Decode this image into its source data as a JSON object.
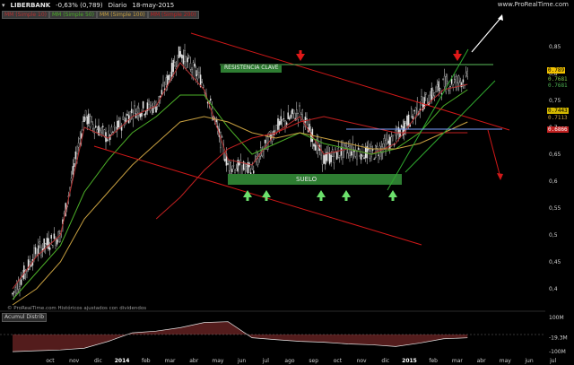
{
  "header": {
    "symbol": "LIBERBANK",
    "change": "-0,63% (0,789)",
    "period": "Diario",
    "date": "18-may-2015",
    "legend": [
      "MM (Simple 10)",
      "MM (Simple 50)",
      "MM (Simple 100)",
      "MM (Simple 200)"
    ],
    "brand": "www.ProRealTime.com"
  },
  "copyright": "© ProRealTime.com  Históricos ajustados con dividendos",
  "indicator_label": "Acumul Distrib",
  "annotations": {
    "resistance_label": "RESISTENCIA CLAVE",
    "support_label": "SUELO"
  },
  "price_tags": [
    {
      "value": "0.789",
      "color": "#f2c200",
      "text_color": "#000"
    },
    {
      "value": "0.7681",
      "color": "#000",
      "text_color": "#7ec84a"
    },
    {
      "value": "0.7681",
      "color": "#000",
      "text_color": "#4caf50"
    },
    {
      "value": "0.7443",
      "color": "#d4b800",
      "text_color": "#000"
    },
    {
      "value": "0.7113",
      "color": "#000",
      "text_color": "#c8a040"
    },
    {
      "value": "0.6866",
      "color": "#c02020",
      "text_color": "#fff"
    }
  ],
  "indicator_ticks": [
    "100M",
    "-19.3M",
    "-100M"
  ],
  "colors": {
    "background": "#000000",
    "candle": "#e8e8e8",
    "ma10": "#b43232",
    "ma50": "#4caf28",
    "ma100": "#c8a040",
    "ma200": "#c02020",
    "trend_red": "#d01818",
    "trend_green": "#2ea82e",
    "resistance_line": "#5cc05c",
    "support_zone": "#2e7d32",
    "ad_fill_pos": "#1f5c1f",
    "ad_fill_neg": "#5c1f1f",
    "arrow_up": "#6ce06c",
    "arrow_down": "#e01818"
  },
  "chart_data": {
    "type": "line",
    "title": "LIBERBANK",
    "xlabel": "",
    "ylabel": "",
    "x_ticks": [
      "oct",
      "nov",
      "dic",
      "2014",
      "feb",
      "mar",
      "abr",
      "may",
      "jun",
      "jul",
      "ago",
      "sep",
      "oct",
      "nov",
      "dic",
      "2015",
      "feb",
      "mar",
      "abr",
      "may",
      "jun",
      "jul"
    ],
    "y_ticks": [
      "0,85",
      "0,8",
      "0,75",
      "0,7",
      "0,65",
      "0,6",
      "0,55",
      "0,5",
      "0,45",
      "0,4"
    ],
    "ylim": [
      0.37,
      0.9
    ],
    "grid": false,
    "price_points": [
      {
        "x": "oct",
        "y": 0.39
      },
      {
        "x": "nov",
        "y": 0.47
      },
      {
        "x": "dic",
        "y": 0.5
      },
      {
        "x": "2014",
        "y": 0.72
      },
      {
        "x": "feb",
        "y": 0.68
      },
      {
        "x": "mar",
        "y": 0.73
      },
      {
        "x": "abr",
        "y": 0.74
      },
      {
        "x": "may",
        "y": 0.84
      },
      {
        "x": "jun",
        "y": 0.78
      },
      {
        "x": "jul",
        "y": 0.63
      },
      {
        "x": "ago",
        "y": 0.62
      },
      {
        "x": "sep",
        "y": 0.7
      },
      {
        "x": "oct",
        "y": 0.73
      },
      {
        "x": "nov",
        "y": 0.64
      },
      {
        "x": "dic",
        "y": 0.66
      },
      {
        "x": "2015",
        "y": 0.65
      },
      {
        "x": "feb",
        "y": 0.68
      },
      {
        "x": "mar",
        "y": 0.74
      },
      {
        "x": "abr",
        "y": 0.78
      },
      {
        "x": "may",
        "y": 0.79
      }
    ],
    "series": [
      {
        "name": "MM (Simple 10)",
        "values": [
          0.4,
          0.46,
          0.5,
          0.7,
          0.68,
          0.72,
          0.74,
          0.82,
          0.77,
          0.64,
          0.63,
          0.69,
          0.72,
          0.65,
          0.66,
          0.65,
          0.67,
          0.73,
          0.77,
          0.78
        ]
      },
      {
        "name": "MM (Simple 50)",
        "values": [
          0.38,
          0.43,
          0.48,
          0.58,
          0.64,
          0.69,
          0.72,
          0.76,
          0.76,
          0.7,
          0.65,
          0.67,
          0.69,
          0.67,
          0.66,
          0.65,
          0.66,
          0.69,
          0.74,
          0.77
        ]
      },
      {
        "name": "MM (Simple 100)",
        "values": [
          0.37,
          0.4,
          0.45,
          0.53,
          0.58,
          0.63,
          0.67,
          0.71,
          0.72,
          0.71,
          0.69,
          0.68,
          0.69,
          0.68,
          0.67,
          0.66,
          0.66,
          0.67,
          0.69,
          0.71
        ]
      },
      {
        "name": "MM (Simple 200)",
        "values": [
          null,
          null,
          null,
          null,
          null,
          null,
          0.53,
          0.57,
          0.62,
          0.66,
          0.68,
          0.69,
          0.71,
          0.72,
          0.71,
          0.7,
          0.69,
          0.69,
          0.69,
          0.69
        ]
      }
    ],
    "indicator": {
      "name": "Acumul Distrib",
      "values": [
        -100,
        -95,
        -90,
        -80,
        -40,
        10,
        20,
        40,
        70,
        75,
        -19,
        -30,
        -40,
        -45,
        -55,
        -60,
        -70,
        -50,
        -25,
        -19.3
      ]
    }
  }
}
